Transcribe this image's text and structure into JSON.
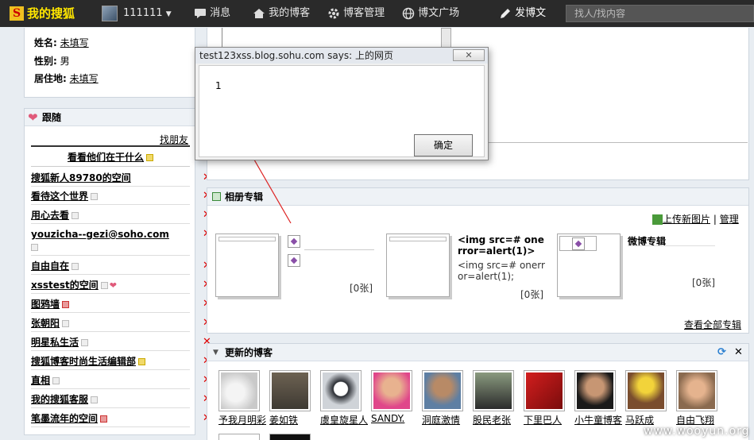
{
  "topbar": {
    "logo_letter": "S",
    "logo_text": "我的搜狐",
    "username": "111111",
    "messages": "消息",
    "my_blog": "我的博客",
    "blog_manage": "博客管理",
    "blog_square": "博文广场",
    "post_blog": "发博文",
    "search_placeholder": "找人/找内容"
  },
  "profile": {
    "name_label": "姓名:",
    "name_value": "未填写",
    "gender_label": "性别:",
    "gender_value": "男",
    "residence_label": "居住地:",
    "residence_value": "未填写"
  },
  "follow": {
    "title": "跟随",
    "find_friends": "找朋友",
    "see_what": "看看他们在干什么",
    "items": [
      {
        "label": "搜狐新人89780的空间"
      },
      {
        "label": "看待这个世界"
      },
      {
        "label": "用心去看"
      },
      {
        "label": "youzicha--gezi@soho.com"
      },
      {
        "label": "自由自在"
      },
      {
        "label": "xsstest的空间"
      },
      {
        "label": "图鸦墙"
      },
      {
        "label": "张朝阳"
      },
      {
        "label": "明星私生活"
      },
      {
        "label": "搜狐博客时尚生活编辑部"
      },
      {
        "label": "直相"
      },
      {
        "label": "我的搜狐客服"
      },
      {
        "label": "笔墨流年的空间"
      }
    ],
    "remove_glyph": "✕"
  },
  "album": {
    "title": "相册专辑",
    "upload": "上传新图片",
    "manage": "管理",
    "sep": "|",
    "cards": [
      {
        "count": "[0张]"
      },
      {
        "title": "<img src=# onerror=alert(1)>",
        "desc": "<img src=# onerror=alert(1);",
        "count": "[0张]"
      },
      {
        "title": "微博专辑",
        "count": "[0张]"
      }
    ],
    "view_all": "查看全部专辑"
  },
  "updated": {
    "title": "更新的博客",
    "close": "✕",
    "blogs": [
      {
        "name": "予我月明彩"
      },
      {
        "name": "姜如铁"
      },
      {
        "name": "虞皇旋星人"
      },
      {
        "name": "SANDY."
      },
      {
        "name": "洞庭激情"
      },
      {
        "name": "股民老张"
      },
      {
        "name": "下里巴人"
      },
      {
        "name": "小牛童博客"
      },
      {
        "name": "马跃成"
      },
      {
        "name": "自由飞翔"
      }
    ]
  },
  "dialog": {
    "title": "test123xss.blog.sohu.com says: 上的网页",
    "close": "✕",
    "message": "1",
    "ok": "确定"
  },
  "watermark": "www.wooyun.org"
}
